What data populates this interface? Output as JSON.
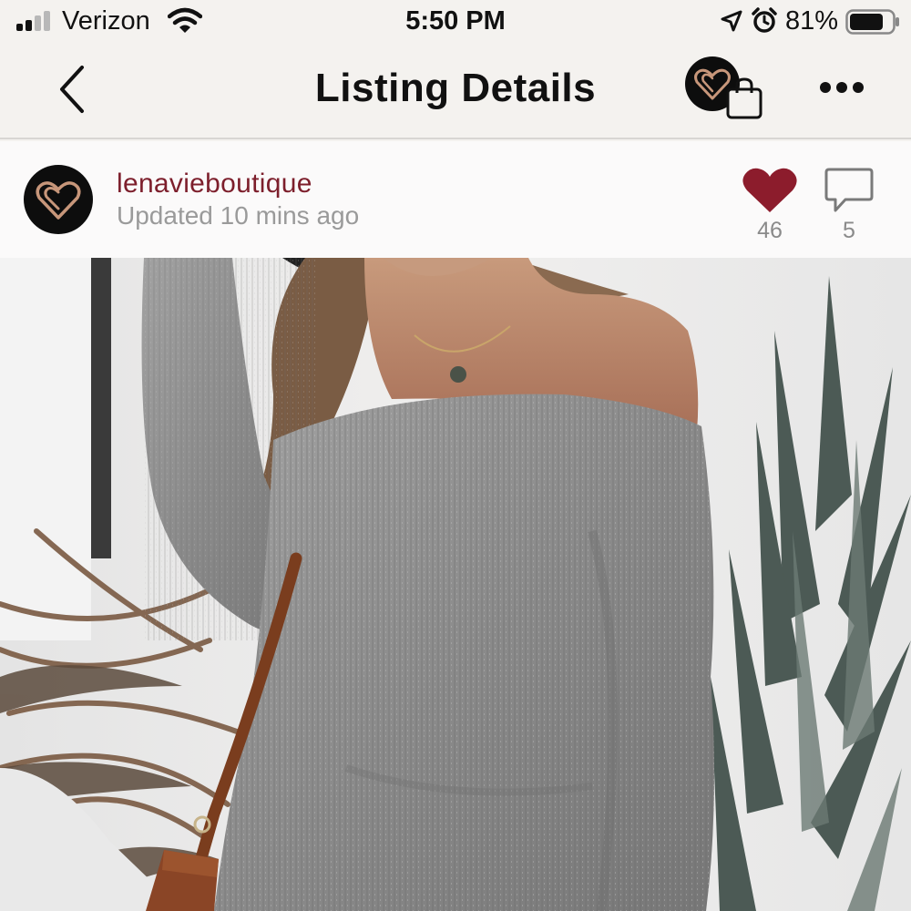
{
  "status_bar": {
    "carrier": "Verizon",
    "time": "5:50 PM",
    "battery_percent": "81%",
    "battery_level": 0.81,
    "signal_bars_active": 2,
    "signal_bars_total": 4,
    "icons": [
      "signal-icon",
      "wifi-icon",
      "location-arrow-icon",
      "alarm-clock-icon",
      "battery-icon"
    ]
  },
  "nav": {
    "title": "Listing Details",
    "icons": [
      "back-chevron-icon",
      "boutique-logo-icon",
      "shopping-bag-icon",
      "more-dots-icon"
    ]
  },
  "seller": {
    "username": "lenavieboutique",
    "updated": "Updated 10 mins ago",
    "likes": "46",
    "comments": "5",
    "icons": [
      "heart-icon",
      "comment-bubble-icon"
    ]
  },
  "colors": {
    "brand_maroon": "#7d1f2c",
    "heart_red": "#8c1c2c",
    "logo_gold": "#c7967a",
    "background": "#f4f2ef"
  }
}
